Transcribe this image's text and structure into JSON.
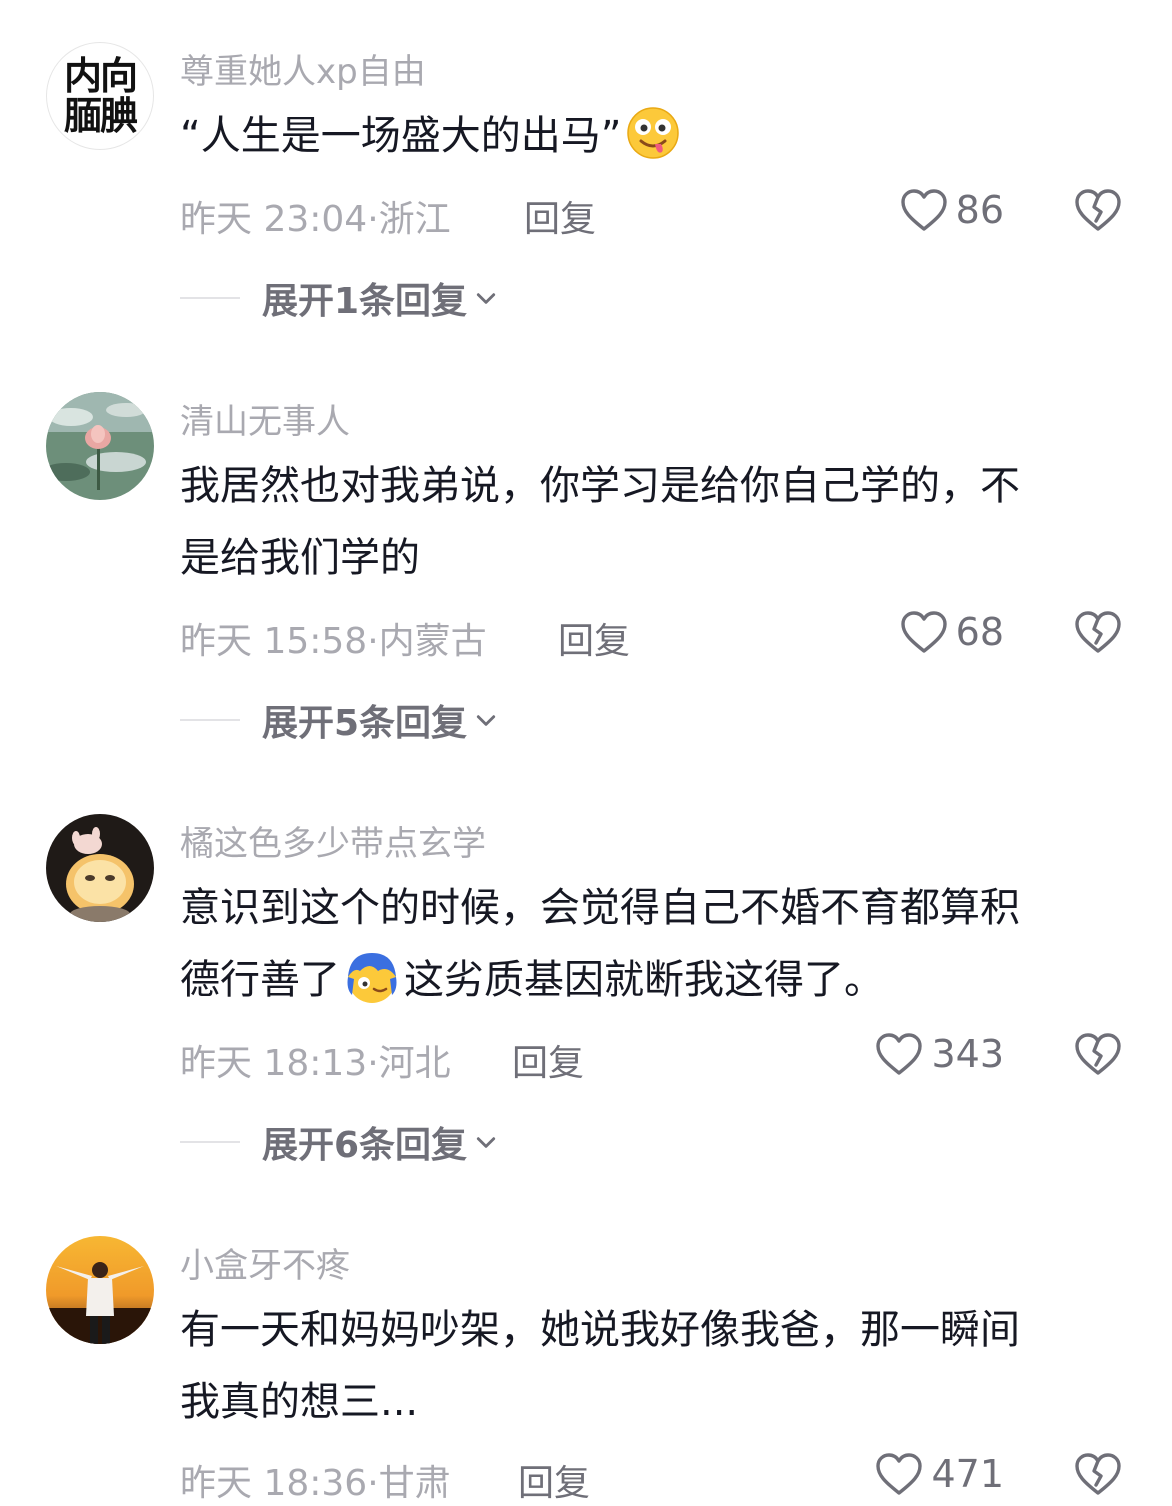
{
  "comments": [
    {
      "avatar_text": [
        "内向",
        "腼腆"
      ],
      "username": "尊重她人xp自由",
      "lines": [
        "“人生是一场盛大的出马”"
      ],
      "emoji": "drooling-face-icon",
      "time": "昨天 23:04",
      "location": "浙江",
      "reply_label": "回复",
      "likes": "86",
      "expand_label": "展开1条回复"
    },
    {
      "avatar_icon": "lotus-pond-avatar",
      "username": "清山无事人",
      "lines": [
        "我居然也对我弟说，你学习是给你自己学的，不",
        "是给我们学的"
      ],
      "time": "昨天 15:58",
      "location": "内蒙古",
      "reply_label": "回复",
      "likes": "68",
      "expand_label": "展开5条回复"
    },
    {
      "avatar_icon": "glowing-pet-avatar",
      "username": "橘这色多少带点玄学",
      "lines_a": "意识到这个的时候，会觉得自己不婚不育都算积",
      "line_b_before": "德行善了",
      "emoji": "blue-hair-face-icon",
      "line_b_after": "这劣质基因就断我这得了。",
      "time": "昨天 18:13",
      "location": "河北",
      "reply_label": "回复",
      "likes": "343",
      "expand_label": "展开6条回复"
    },
    {
      "avatar_icon": "sunset-person-avatar",
      "username": "小盒牙不疼",
      "lines": [
        "有一天和妈妈吵架，她说我好像我爸，那一瞬间",
        "我真的想三..."
      ],
      "time": "昨天 18:36",
      "location": "甘肃",
      "reply_label": "回复",
      "likes": "471"
    }
  ],
  "separator": "·",
  "colors": {
    "primary_text": "#161823",
    "secondary_text": "#a9a9b0",
    "action_text": "#6f6f78"
  }
}
